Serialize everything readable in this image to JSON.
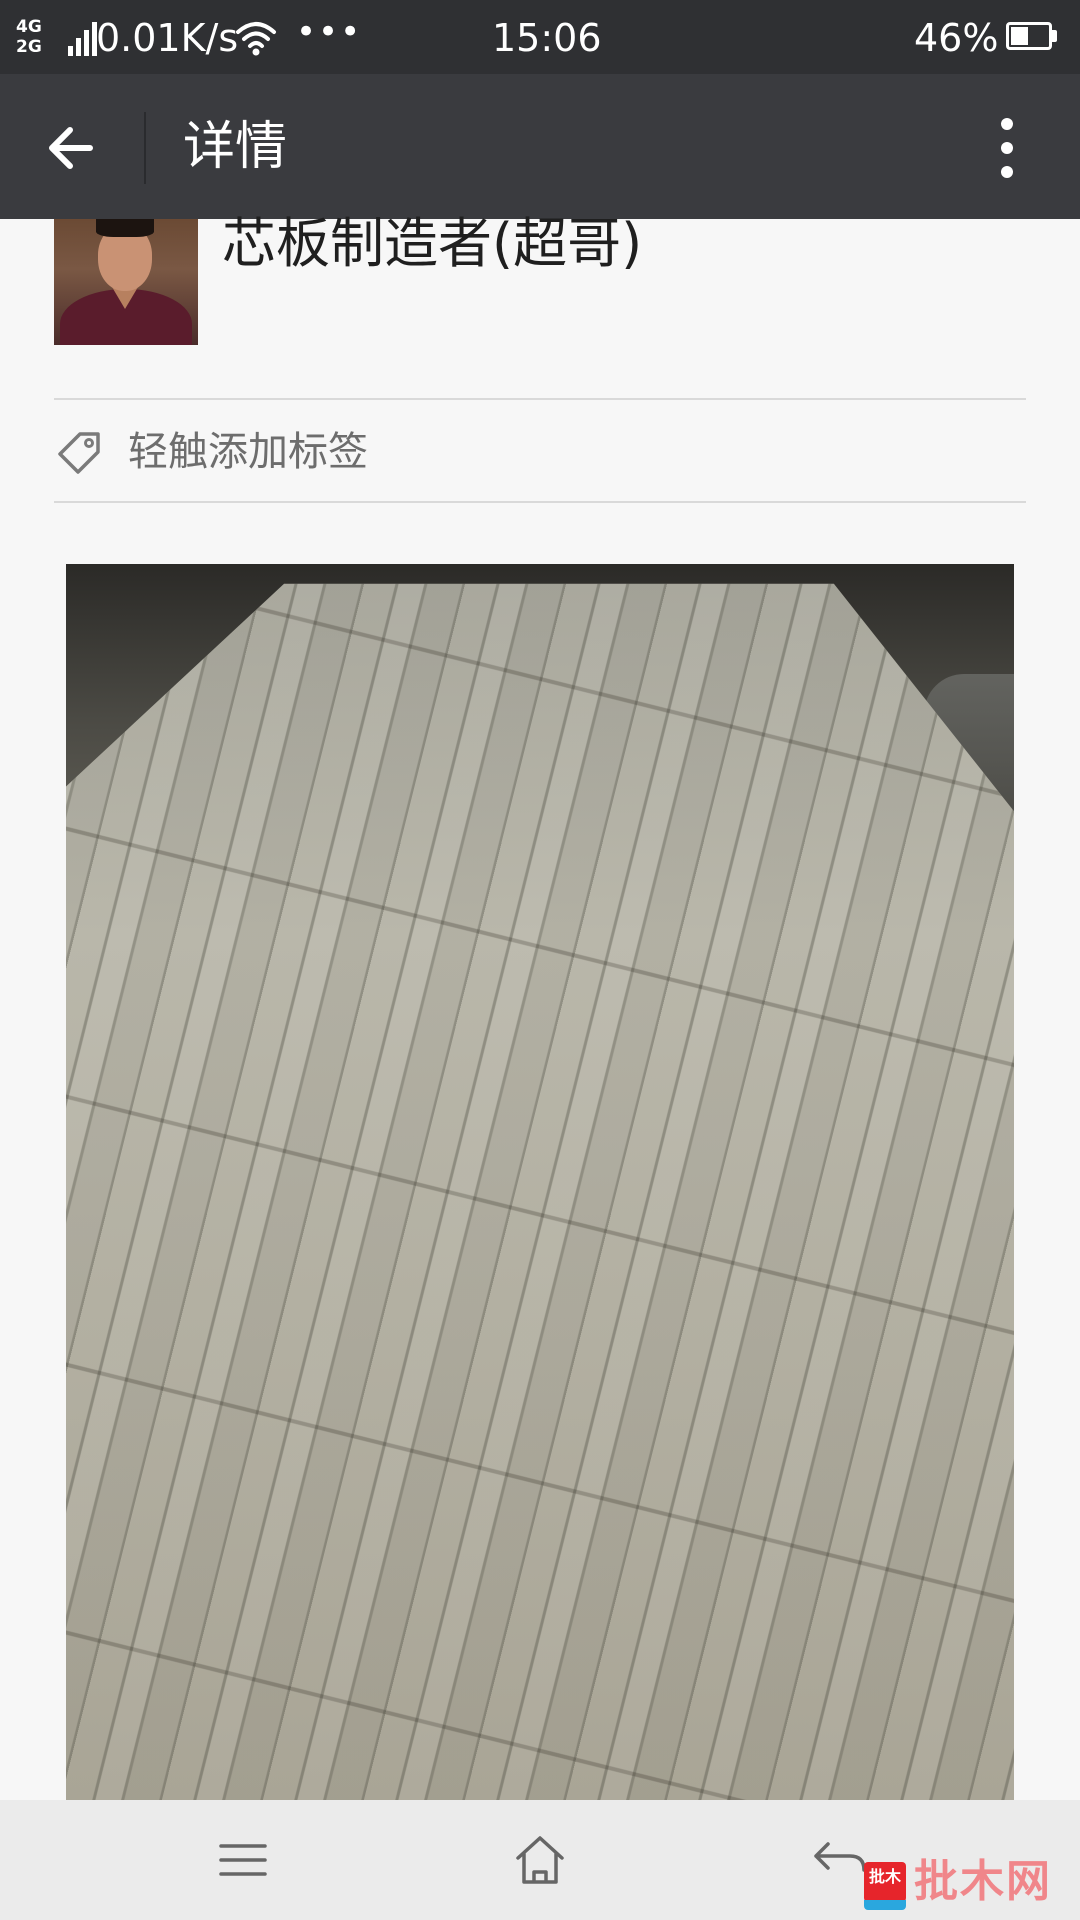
{
  "status_bar": {
    "network_top": "4G",
    "network_bottom": "2G",
    "speed": "0.01K/s",
    "dots": "•••",
    "time": "15:06",
    "battery_percent": "46%",
    "battery_level": 0.46
  },
  "action_bar": {
    "title": "详情"
  },
  "profile": {
    "name": "芯板制造者(超哥)"
  },
  "tag_row": {
    "label": "轻触添加标签"
  },
  "watermark": {
    "badge_text": "批木",
    "text": "批木网"
  },
  "icons": {
    "back": "arrow-left-icon",
    "more": "more-vertical-icon",
    "tag": "tag-icon",
    "menu": "menu-icon",
    "home": "home-icon",
    "return": "back-return-icon"
  }
}
